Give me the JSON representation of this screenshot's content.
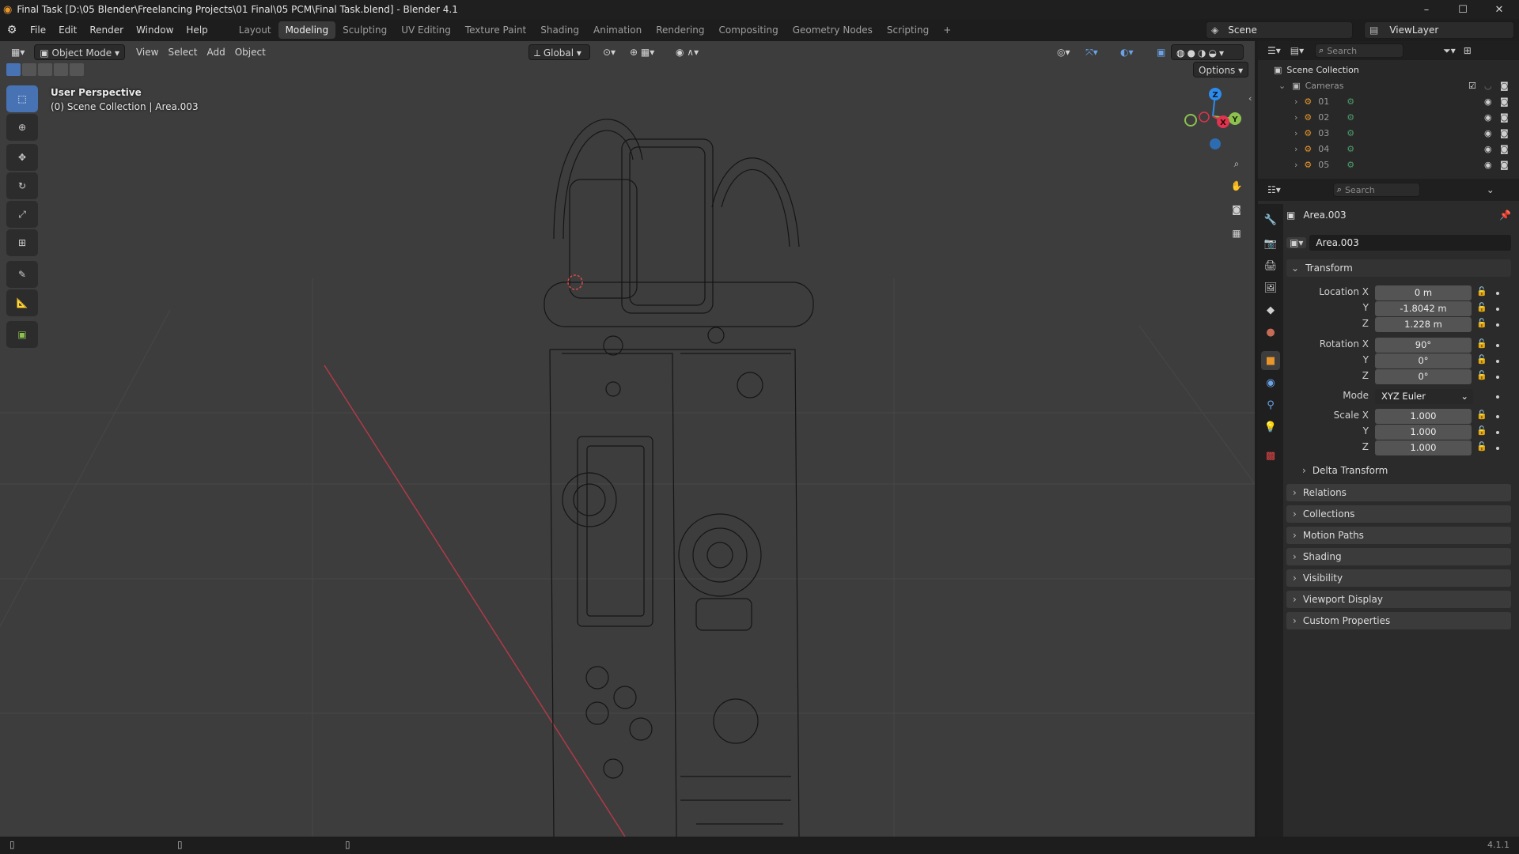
{
  "window": {
    "title": "Final Task [D:\\05 Blender\\Freelancing Projects\\01 Final\\05 PCM\\Final Task.blend] - Blender 4.1",
    "minimize": "–",
    "maximize": "☐",
    "close": "✕"
  },
  "menu": [
    "File",
    "Edit",
    "Render",
    "Window",
    "Help"
  ],
  "workspaces": [
    "Layout",
    "Modeling",
    "Sculpting",
    "UV Editing",
    "Texture Paint",
    "Shading",
    "Animation",
    "Rendering",
    "Compositing",
    "Geometry Nodes",
    "Scripting"
  ],
  "workspace_add": "+",
  "active_workspace": "Modeling",
  "scene": {
    "name": "Scene",
    "view_layer": "ViewLayer"
  },
  "viewport": {
    "mode": "Object Mode",
    "menus": [
      "View",
      "Select",
      "Add",
      "Object"
    ],
    "orientation": "Global",
    "options": "Options",
    "overlay_title": "User Perspective",
    "overlay_subtitle": "(0) Scene Collection | Area.003",
    "gizmo": {
      "z": "Z",
      "x": "X",
      "y": "Y"
    }
  },
  "outliner": {
    "search_placeholder": "Search",
    "root": "Scene Collection",
    "collection": "Cameras",
    "items": [
      "01",
      "02",
      "03",
      "04",
      "05"
    ]
  },
  "properties": {
    "search_placeholder": "Search",
    "object_name": "Area.003",
    "object_field": "Area.003",
    "transform_title": "Transform",
    "location": {
      "label_x": "Location X",
      "label_y": "Y",
      "label_z": "Z",
      "x": "0 m",
      "y": "-1.8042 m",
      "z": "1.228 m"
    },
    "rotation": {
      "label_x": "Rotation X",
      "label_y": "Y",
      "label_z": "Z",
      "x": "90°",
      "y": "0°",
      "z": "0°"
    },
    "mode_label": "Mode",
    "mode": "XYZ Euler",
    "scale": {
      "label_x": "Scale X",
      "label_y": "Y",
      "label_z": "Z",
      "x": "1.000",
      "y": "1.000",
      "z": "1.000"
    },
    "delta": "Delta Transform",
    "panels": [
      "Relations",
      "Collections",
      "Motion Paths",
      "Shading",
      "Visibility",
      "Viewport Display",
      "Custom Properties"
    ]
  },
  "status": {
    "version": "4.1.1"
  },
  "colors": {
    "accent": "#4772b3",
    "axis_x": "#e0334f",
    "axis_y": "#8cc14f",
    "axis_z": "#2d8ceb",
    "orange": "#e8962c"
  }
}
